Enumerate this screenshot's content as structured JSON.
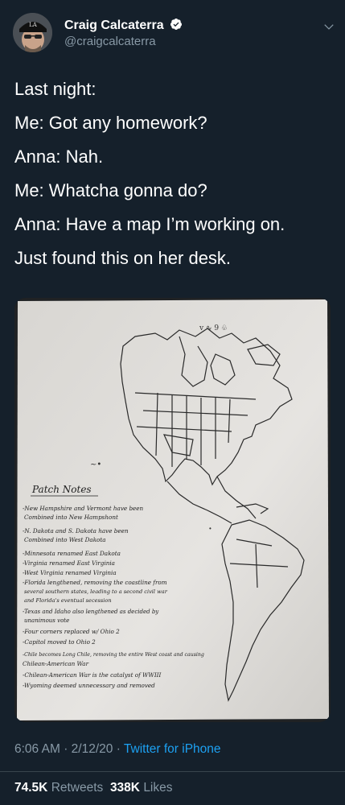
{
  "author": {
    "name": "Craig Calcaterra",
    "handle": "@craigcalcaterra",
    "avatar": "avatar"
  },
  "tweet_lines": [
    "Last night:",
    "Me: Got any homework?",
    "Anna: Nah.",
    "Me: Whatcha gonna do?",
    "Anna: Have a map I’m working on.",
    "Just found this on her desk."
  ],
  "media": {
    "notes_title": "Patch Notes",
    "notes": [
      "-New Hampshire and Vermont have been",
      "Combined into New Hampshont",
      "-N. Dakota and S. Dakota have been",
      "Combined into West Dakota",
      "-Minnesota renamed East Dakota",
      "-Virginia renamed East Virginia",
      "-West Virginia renamed Virginia",
      "-Florida lengthened, removing the coastline from",
      "several southern states, leading to a second civil war",
      "and Florida's eventual secession",
      "-Texas and Idaho also lengthened as decided by",
      "unanimous vote",
      "-Four corners replaced w/ Ohio 2",
      "-Capitol moved to Ohio 2",
      "-Chile becomes Long Chile, removing the entire West coast and causing",
      "Chilean-American War",
      "-Chilean-American War is the catalyst of WWIII",
      "-Wyoming deemed unnecessary and removed"
    ]
  },
  "timestamp": {
    "time": "6:06 AM",
    "date": "2/12/20",
    "sep": "·",
    "source": "Twitter for iPhone"
  },
  "stats": {
    "retweets_count": "74.5K",
    "retweets_label": "Retweets",
    "likes_count": "338K",
    "likes_label": "Likes"
  },
  "colors": {
    "background": "#15202b",
    "secondary_text": "#8899a6",
    "link": "#1da1f2",
    "verified": "#1da1f2",
    "divider": "#38444d"
  }
}
